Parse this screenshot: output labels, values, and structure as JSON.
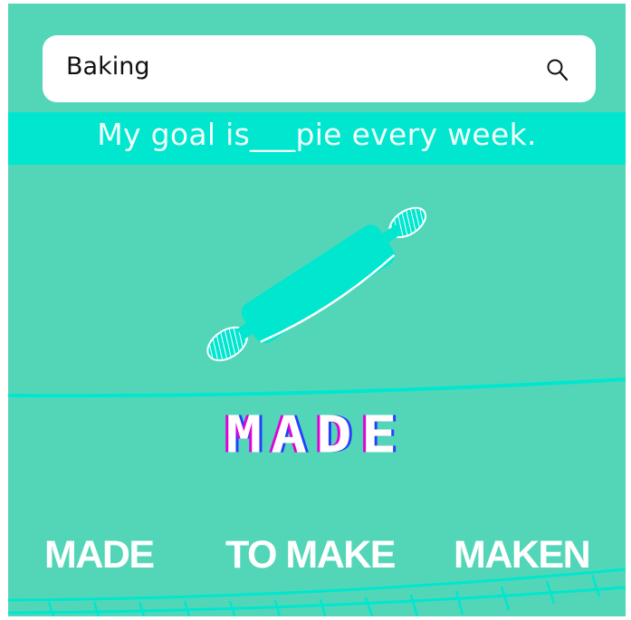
{
  "search": {
    "value": "Baking",
    "icon": "search-icon"
  },
  "prompt": {
    "text": "My goal is___pie every week."
  },
  "illustration": {
    "icon": "rolling-pin-icon"
  },
  "logo": {
    "text": "MADE"
  },
  "menu": {
    "items": [
      {
        "label": "MADE"
      },
      {
        "label": "TO MAKE"
      },
      {
        "label": "MAKEN"
      }
    ]
  },
  "colors": {
    "background": "#53d6b8",
    "accent": "#00e6cf",
    "logo_shadow_left": "#e000d8",
    "logo_shadow_right": "#2340ff"
  }
}
